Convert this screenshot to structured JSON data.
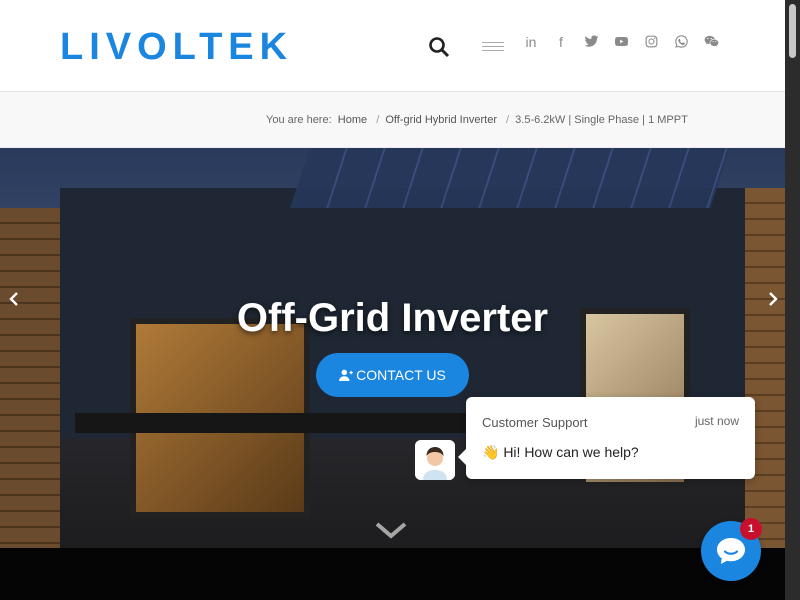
{
  "brand": {
    "logo_text": "LIVOLTEK",
    "accent": "#1a86e0"
  },
  "header": {
    "social": [
      "linkedin-icon",
      "facebook-icon",
      "twitter-icon",
      "youtube-icon",
      "instagram-icon",
      "whatsapp-icon",
      "wechat-icon"
    ],
    "linkedin_glyph": "in",
    "facebook_glyph": "f"
  },
  "breadcrumb": {
    "prefix": "You are here:",
    "items": [
      "Home",
      "Off-grid Hybrid Inverter",
      "3.5-6.2kW | Single Phase | 1 MPPT"
    ],
    "separator": "/"
  },
  "hero": {
    "title": "Off-Grid Inverter",
    "cta_label": "CONTACT US"
  },
  "chat": {
    "agent_name": "Customer Support",
    "time": "just now",
    "message": "👋 Hi! How can we help?",
    "badge_count": "1"
  }
}
